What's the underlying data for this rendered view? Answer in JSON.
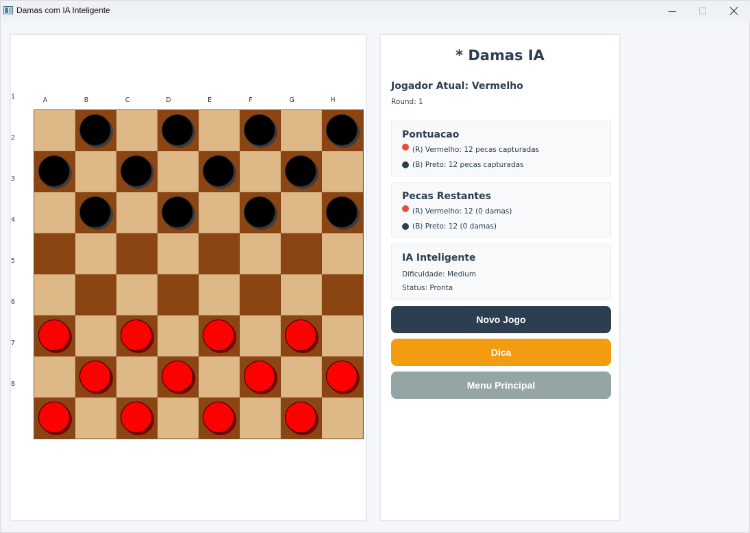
{
  "window": {
    "title": "Damas com IA Inteligente"
  },
  "board": {
    "columns": [
      "A",
      "B",
      "C",
      "D",
      "E",
      "F",
      "G",
      "H"
    ],
    "rows": [
      "1",
      "2",
      "3",
      "4",
      "5",
      "6",
      "7",
      "8"
    ],
    "layout": [
      [
        "",
        "b",
        "",
        "b",
        "",
        "b",
        "",
        "b"
      ],
      [
        "b",
        "",
        "b",
        "",
        "b",
        "",
        "b",
        ""
      ],
      [
        "",
        "b",
        "",
        "b",
        "",
        "b",
        "",
        "b"
      ],
      [
        "",
        "",
        "",
        "",
        "",
        "",
        "",
        ""
      ],
      [
        "",
        "",
        "",
        "",
        "",
        "",
        "",
        ""
      ],
      [
        "r",
        "",
        "r",
        "",
        "r",
        "",
        "r",
        ""
      ],
      [
        "",
        "r",
        "",
        "r",
        "",
        "r",
        "",
        "r"
      ],
      [
        "r",
        "",
        "r",
        "",
        "r",
        "",
        "r",
        ""
      ]
    ],
    "colors": {
      "light": "#deb887",
      "dark": "#8b4513",
      "red_piece": "#ff0000",
      "black_piece": "#000000"
    }
  },
  "info": {
    "title": "* Damas IA",
    "current_player": "Jogador Atual: Vermelho",
    "round": "Round: 1",
    "score": {
      "title": "Pontuacao",
      "red": "(R) Vermelho: 12 pecas capturadas",
      "black": "(B) Preto: 12 pecas capturadas"
    },
    "remaining": {
      "title": "Pecas Restantes",
      "red": "(R) Vermelho: 12 (0 damas)",
      "black": "(B) Preto: 12 (0 damas)"
    },
    "ai": {
      "title": "IA Inteligente",
      "difficulty": "Dificuldade: Medium",
      "status": "Status: Pronta"
    },
    "buttons": {
      "new_game": "Novo Jogo",
      "hint": "Dica",
      "main_menu": "Menu Principal"
    }
  }
}
